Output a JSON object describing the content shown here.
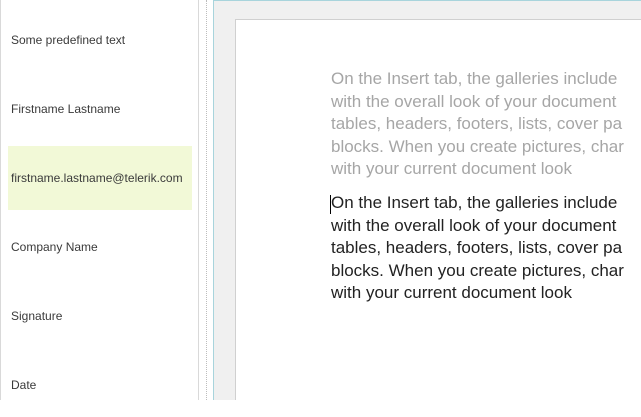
{
  "fields_panel": {
    "items": [
      {
        "label": "Some predefined text"
      },
      {
        "label": "Firstname Lastname"
      },
      {
        "label": "firstname.lastname@telerik.com"
      },
      {
        "label": "Company Name"
      },
      {
        "label": "Signature"
      },
      {
        "label": "Date"
      }
    ],
    "selected_index": 2,
    "selected_color": "#f2f9d7"
  },
  "document": {
    "watermark_lines": [
      "On the Insert tab, the galleries include",
      "with the overall look of your document",
      "tables, headers, footers, lists, cover pa",
      "blocks. When you create pictures, char",
      "with your current document look"
    ],
    "body_lines": [
      "On the Insert tab, the galleries include",
      "with the overall look of your document",
      "tables, headers, footers, lists, cover pa",
      "blocks. When you create pictures, char",
      "with your current document look"
    ]
  }
}
